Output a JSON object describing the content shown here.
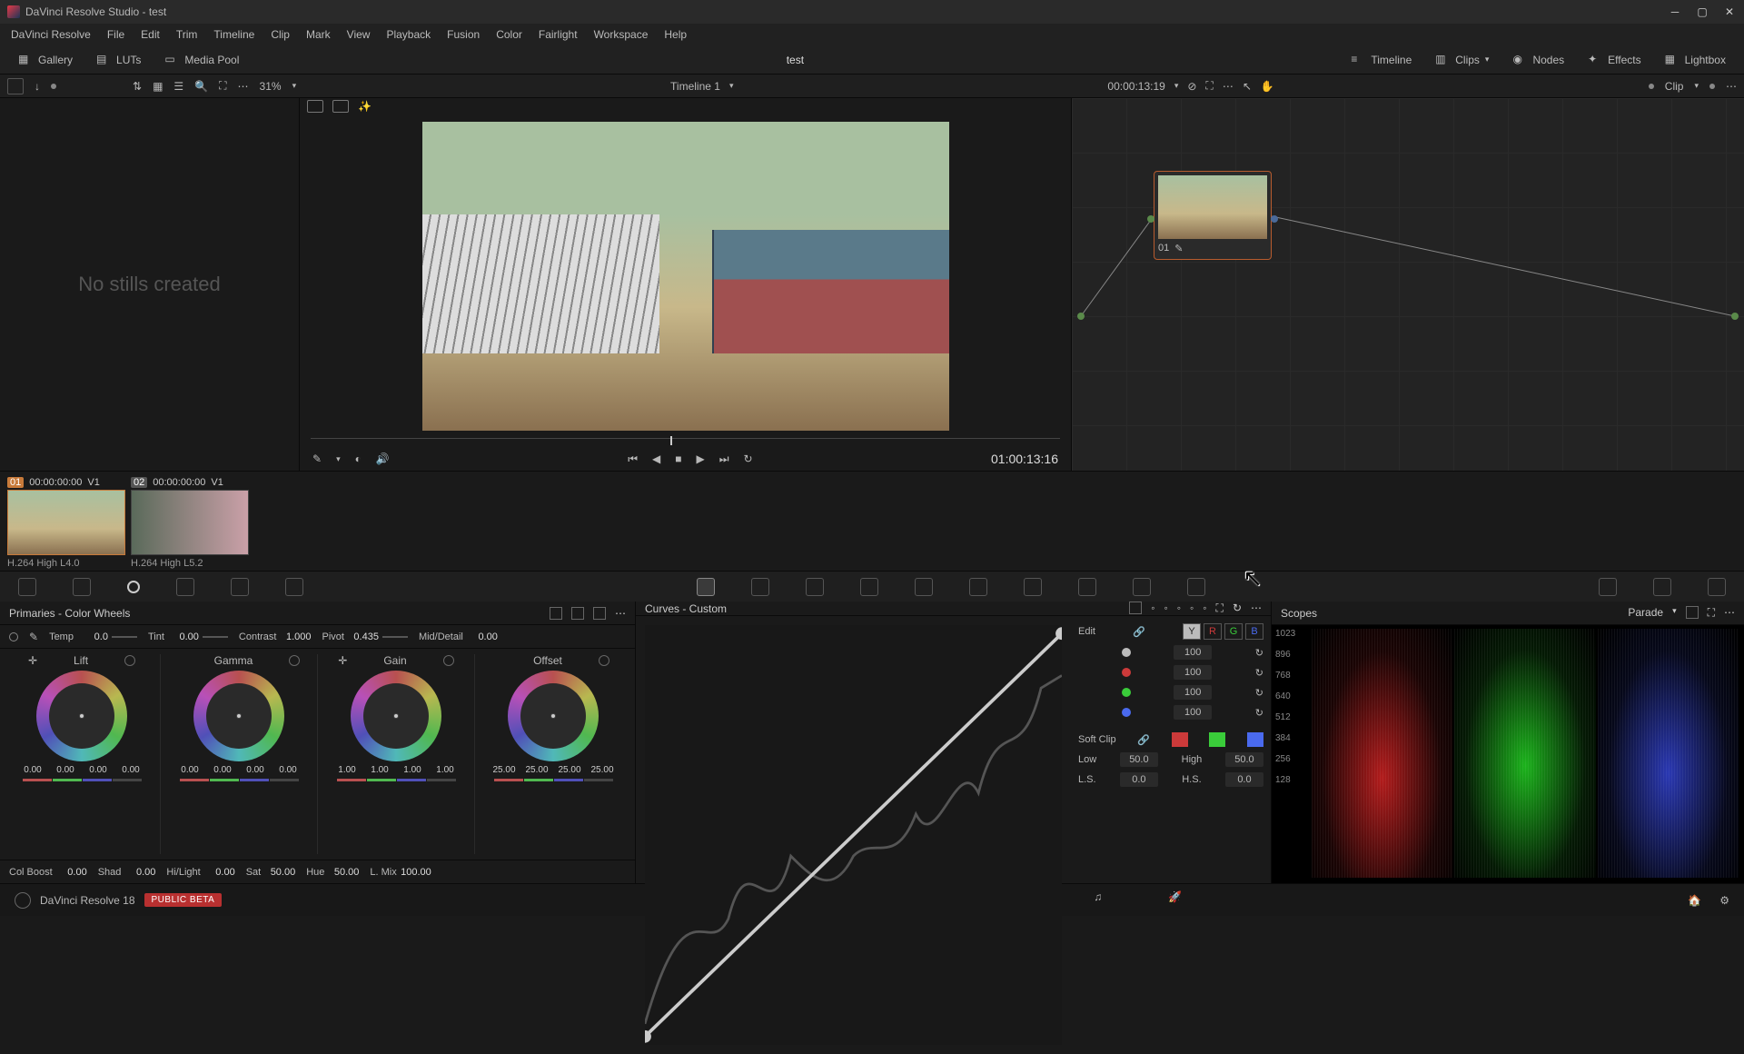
{
  "titlebar": {
    "title": "DaVinci Resolve Studio - test"
  },
  "menubar": [
    "DaVinci Resolve",
    "File",
    "Edit",
    "Trim",
    "Timeline",
    "Clip",
    "Mark",
    "View",
    "Playback",
    "Fusion",
    "Color",
    "Fairlight",
    "Workspace",
    "Help"
  ],
  "toolbar": {
    "gallery": "Gallery",
    "luts": "LUTs",
    "mediapool": "Media Pool",
    "project": "test",
    "timeline_btn": "Timeline",
    "clips_btn": "Clips",
    "nodes_btn": "Nodes",
    "effects_btn": "Effects",
    "lightbox_btn": "Lightbox"
  },
  "viewer_sub": {
    "zoom": "31%",
    "timeline_name": "Timeline 1",
    "duration": "00:00:13:19",
    "clip_label": "Clip"
  },
  "gallery": {
    "empty": "No stills created"
  },
  "viewer": {
    "timecode": "01:00:13:16"
  },
  "node": {
    "label": "01"
  },
  "clips": [
    {
      "num": "01",
      "tc": "00:00:00:00",
      "track": "V1",
      "codec": "H.264 High L4.0"
    },
    {
      "num": "02",
      "tc": "00:00:00:00",
      "track": "V1",
      "codec": "H.264 High L5.2"
    }
  ],
  "wheels": {
    "title": "Primaries - Color Wheels",
    "temp": {
      "label": "Temp",
      "value": "0.0"
    },
    "tint": {
      "label": "Tint",
      "value": "0.00"
    },
    "contrast": {
      "label": "Contrast",
      "value": "1.000"
    },
    "pivot": {
      "label": "Pivot",
      "value": "0.435"
    },
    "middetail": {
      "label": "Mid/Detail",
      "value": "0.00"
    },
    "columns": [
      {
        "name": "Lift",
        "vals": [
          "0.00",
          "0.00",
          "0.00",
          "0.00"
        ]
      },
      {
        "name": "Gamma",
        "vals": [
          "0.00",
          "0.00",
          "0.00",
          "0.00"
        ]
      },
      {
        "name": "Gain",
        "vals": [
          "1.00",
          "1.00",
          "1.00",
          "1.00"
        ]
      },
      {
        "name": "Offset",
        "vals": [
          "25.00",
          "25.00",
          "25.00",
          "25.00"
        ]
      }
    ],
    "colboost": {
      "label": "Col Boost",
      "value": "0.00"
    },
    "shad": {
      "label": "Shad",
      "value": "0.00"
    },
    "hilight": {
      "label": "Hi/Light",
      "value": "0.00"
    },
    "sat": {
      "label": "Sat",
      "value": "50.00"
    },
    "hue": {
      "label": "Hue",
      "value": "50.00"
    },
    "lmix": {
      "label": "L. Mix",
      "value": "100.00"
    }
  },
  "curves": {
    "title": "Curves - Custom",
    "edit_label": "Edit",
    "channels": [
      "Y",
      "R",
      "G",
      "B"
    ],
    "intensity": [
      {
        "color": "#bbbbbb",
        "value": "100"
      },
      {
        "color": "#cc3a3a",
        "value": "100"
      },
      {
        "color": "#3acc3a",
        "value": "100"
      },
      {
        "color": "#4a6aee",
        "value": "100"
      }
    ],
    "softclip_label": "Soft Clip",
    "low": {
      "label": "Low",
      "value": "50.0"
    },
    "high": {
      "label": "High",
      "value": "50.0"
    },
    "ls": {
      "label": "L.S.",
      "value": "0.0"
    },
    "hs": {
      "label": "H.S.",
      "value": "0.0"
    }
  },
  "scopes": {
    "title": "Scopes",
    "mode": "Parade",
    "ticks": [
      "1023",
      "896",
      "768",
      "640",
      "512",
      "384",
      "256",
      "128"
    ]
  },
  "pagebar": {
    "app": "DaVinci Resolve 18",
    "beta": "PUBLIC BETA"
  }
}
